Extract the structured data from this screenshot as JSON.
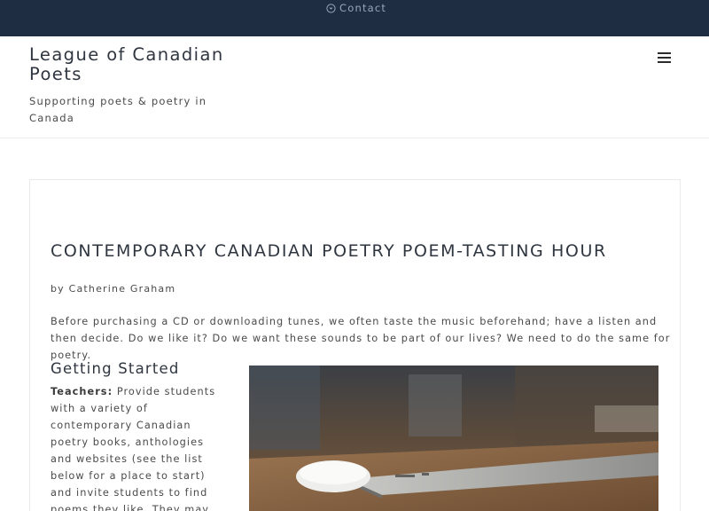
{
  "topbar": {
    "contact_label": "Contact",
    "contact_icon": "chevron-circle-down-icon",
    "background": "#1e2d42"
  },
  "header": {
    "site_title": "League of Canadian Poets",
    "tagline": "Supporting poets & poetry in Canada",
    "menu_icon": "hamburger-menu-icon"
  },
  "article": {
    "title": "CONTEMPORARY CANADIAN POETRY POEM-TASTING HOUR",
    "byline": "by Catherine Graham",
    "intro": "Before purchasing a CD or downloading tunes, we often taste the music beforehand; have a listen and then decide. Do we like it? Do we want these sounds to be part of our lives? We need to do the same for poetry.",
    "section_heading": "Getting Started",
    "teachers_label": "Teachers:",
    "teachers_text": "Provide students with a variety of contemporary Canadian poetry books, anthologies and websites (see the list below for a place to start) and invite students to find poems they like. They may think of themselves as poetry",
    "image_subject": "laptop and mouse on a wooden desk"
  }
}
